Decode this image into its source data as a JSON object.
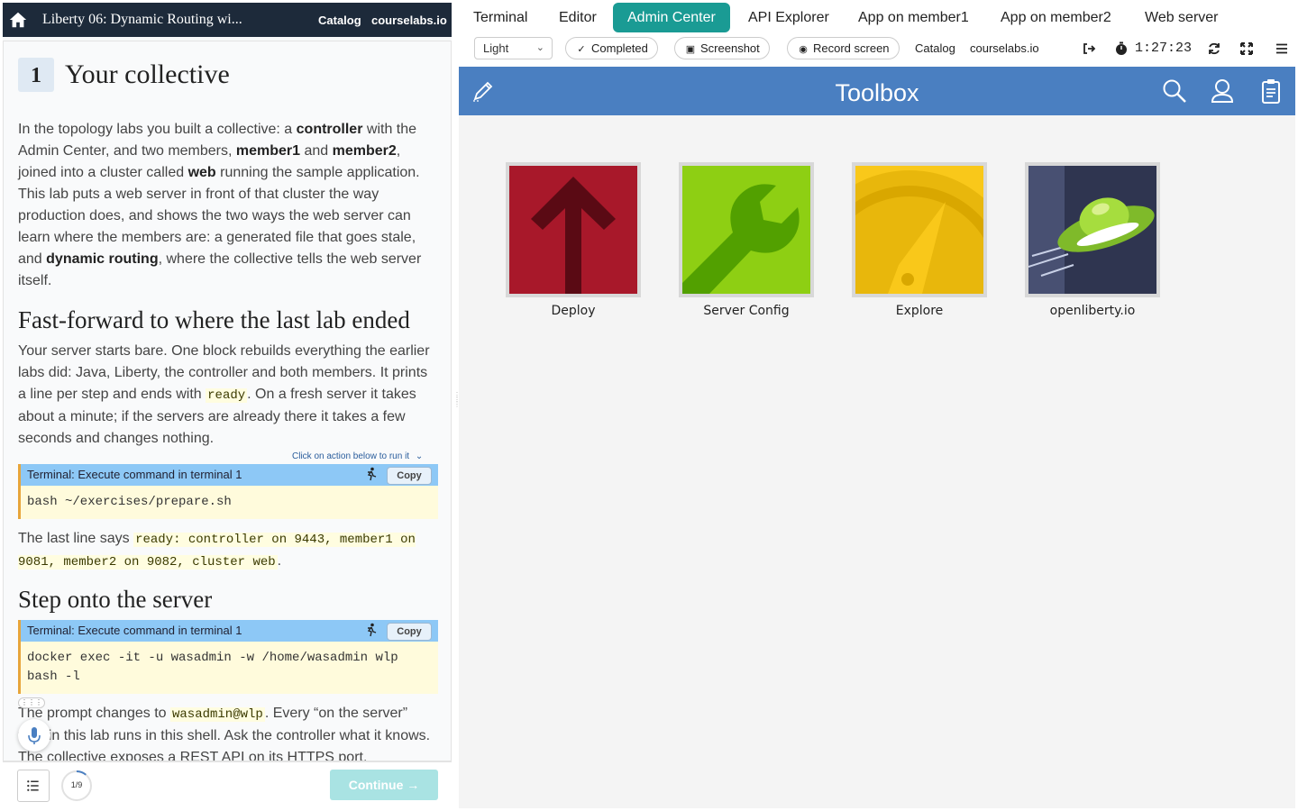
{
  "left": {
    "header": {
      "title": "Liberty 06: Dynamic Routing wi...",
      "catalog": "Catalog",
      "site": "courselabs.io"
    },
    "step": {
      "number": "1",
      "title": "Your collective"
    },
    "intro": {
      "t1": "In the topology labs you built a collective: a ",
      "b1": "controller",
      "t2": " with the Admin Center, and two members, ",
      "b2": "member1",
      "t3": " and ",
      "b3": "member2",
      "t4": ", joined into a cluster called ",
      "b4": "web",
      "t5": " running the sample application. This lab puts a web server in front of that cluster the way production does, and shows the two ways the web server can learn where the members are: a generated file that goes stale, and ",
      "b5": "dynamic routing",
      "t6": ", where the collective tells the web server itself."
    },
    "section1": {
      "heading": "Fast-forward to where the last lab ended",
      "t1": "Your server starts bare. One block rebuilds everything the earlier labs did: Java, Liberty, the controller and both members. It prints a line per step and ends with ",
      "c1": "ready",
      "t2": ". On a fresh server it takes about a minute; if the servers are already there it takes a few seconds and changes nothing."
    },
    "hint": "Click on action below to run it",
    "cmd1": {
      "label": "Terminal: Execute command in terminal 1",
      "copy": "Copy",
      "code": "bash ~/exercises/prepare.sh"
    },
    "after_cmd1": {
      "t1": "The last line says ",
      "c1": "ready: controller on 9443, member1 on 9081, member2 on 9082, cluster web",
      "t2": "."
    },
    "section2": {
      "heading": "Step onto the server"
    },
    "cmd2": {
      "label": "Terminal: Execute command in terminal 1",
      "copy": "Copy",
      "code_line1": "docker exec -it -u wasadmin -w /home/wasadmin wlp",
      "code_line2": "bash -l"
    },
    "after_cmd2": {
      "t1": "The prompt changes to ",
      "c1": "wasadmin@wlp",
      "t2": ". Every “on the server” task in this lab runs in this shell. Ask the controller what it knows. The collective exposes a REST API on its HTTPS port."
    },
    "footer": {
      "progress": "1/9",
      "progress_fraction": 0.111,
      "continue": "Continue →"
    }
  },
  "tabs": [
    {
      "label": "Terminal",
      "active": false
    },
    {
      "label": "Editor",
      "active": false
    },
    {
      "label": "Admin Center",
      "active": true
    },
    {
      "label": "API Explorer",
      "active": false
    },
    {
      "label": "App on member1",
      "active": false
    },
    {
      "label": "App on member2",
      "active": false
    },
    {
      "label": "Web server",
      "active": false
    }
  ],
  "toolbar": {
    "theme": "Light",
    "completed": "Completed",
    "screenshot": "Screenshot",
    "record": "Record screen",
    "catalog": "Catalog",
    "site": "courselabs.io",
    "timer": "1:27:23"
  },
  "admin": {
    "title": "Toolbox",
    "tools": [
      {
        "label": "Deploy",
        "icon": "up-arrow-icon",
        "color": "#a8182a"
      },
      {
        "label": "Server Config",
        "icon": "wrench-icon",
        "color": "#8ecf13"
      },
      {
        "label": "Explore",
        "icon": "compass-icon",
        "color": "#f9c81a"
      },
      {
        "label": "openliberty.io",
        "icon": "ufo-icon",
        "color": "#2f3550"
      }
    ]
  },
  "colors": {
    "accent_tab": "#1a9b94",
    "appbar": "#4a7fc1",
    "left_header": "#1d2a3a",
    "command_header": "#8dc8f6",
    "command_body": "#fffbdc"
  }
}
